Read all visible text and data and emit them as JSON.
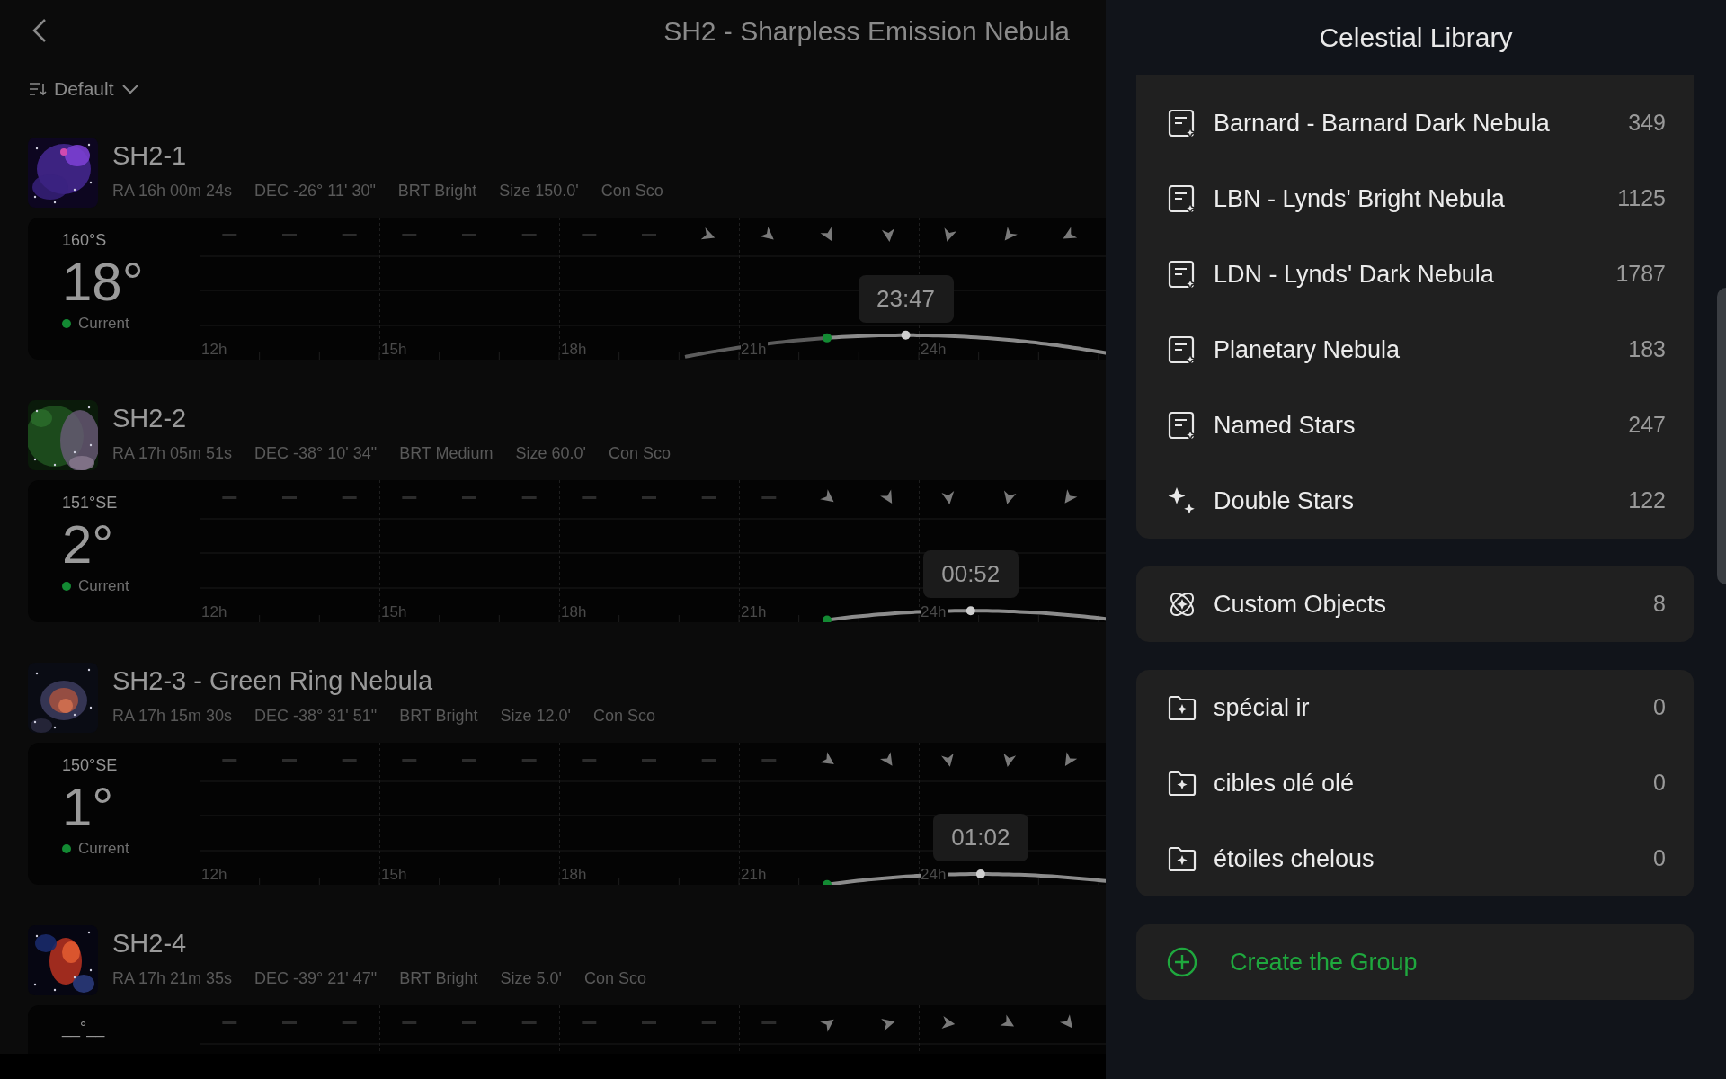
{
  "header": {
    "title": "SH2 - Sharpless Emission Nebula",
    "sort": "Default"
  },
  "objects": [
    {
      "name": "SH2-1",
      "meta": [
        "RA 16h 00m 24s",
        "DEC -26° 11' 30\"",
        "BRT Bright",
        "Size 150.0'",
        "Con Sco"
      ],
      "azimuth": "160°S",
      "altitude": "18°",
      "status": "Current",
      "hours": [
        "12h",
        "15h",
        "18h",
        "21h",
        "24h"
      ],
      "transit": "23:47"
    },
    {
      "name": "SH2-2",
      "meta": [
        "RA 17h 05m 51s",
        "DEC -38° 10' 34\"",
        "BRT Medium",
        "Size 60.0'",
        "Con Sco"
      ],
      "azimuth": "151°SE",
      "altitude": "2°",
      "status": "Current",
      "hours": [
        "12h",
        "15h",
        "18h",
        "21h",
        "24h"
      ],
      "transit": "00:52"
    },
    {
      "name": "SH2-3 - Green Ring Nebula",
      "meta": [
        "RA 17h 15m 30s",
        "DEC -38° 31' 51\"",
        "BRT Bright",
        "Size 12.0'",
        "Con Sco"
      ],
      "azimuth": "150°SE",
      "altitude": "1°",
      "status": "Current",
      "hours": [
        "12h",
        "15h",
        "18h",
        "21h",
        "24h"
      ],
      "transit": "01:02"
    },
    {
      "name": "SH2-4",
      "meta": [
        "RA 17h 21m 35s",
        "DEC -39° 21' 47\"",
        "BRT Bright",
        "Size 5.0'",
        "Con Sco"
      ],
      "azimuth": "__°__"
    }
  ],
  "library": {
    "title": "Celestial Library",
    "catalogs": [
      {
        "label": "Barnard - Barnard Dark Nebula",
        "count": "349",
        "kind": "catalog"
      },
      {
        "label": "LBN - Lynds' Bright Nebula",
        "count": "1125",
        "kind": "catalog"
      },
      {
        "label": "LDN - Lynds' Dark Nebula",
        "count": "1787",
        "kind": "catalog"
      },
      {
        "label": "Planetary Nebula",
        "count": "183",
        "kind": "catalog"
      },
      {
        "label": "Named Stars",
        "count": "247",
        "kind": "catalog"
      },
      {
        "label": "Double Stars",
        "count": "122",
        "kind": "stars"
      }
    ],
    "custom": {
      "label": "Custom Objects",
      "count": "8"
    },
    "groups": [
      {
        "label": "spécial ir",
        "count": "0"
      },
      {
        "label": "cibles olé olé",
        "count": "0"
      },
      {
        "label": "étoiles chelous",
        "count": "0"
      }
    ],
    "create": "Create the Group"
  }
}
